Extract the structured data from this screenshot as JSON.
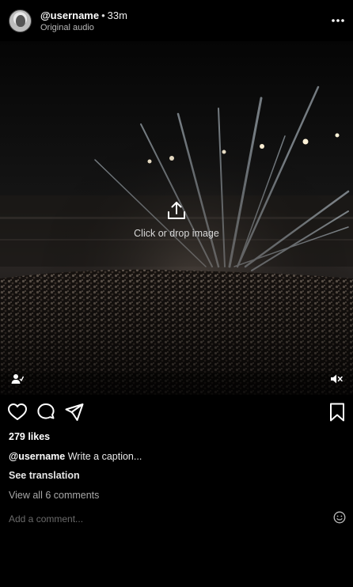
{
  "post": {
    "username": "@username",
    "separator": "•",
    "time": "33m",
    "audio": "Original audio"
  },
  "media": {
    "upload_label": "Click or drop image"
  },
  "icons": {
    "more": "more-options-icon",
    "upload": "upload-icon",
    "tag": "tag-people-icon",
    "mute": "volume-muted-icon",
    "like": "heart-icon",
    "comment": "comment-bubble-icon",
    "share": "paper-plane-icon",
    "save": "bookmark-icon",
    "emoji": "emoji-icon"
  },
  "engagement": {
    "likes": "279 likes",
    "caption_user": "@username",
    "caption_text": "Write a caption...",
    "see_translation": "See translation",
    "view_comments": "View all 6 comments",
    "comment_placeholder": "Add a comment..."
  }
}
